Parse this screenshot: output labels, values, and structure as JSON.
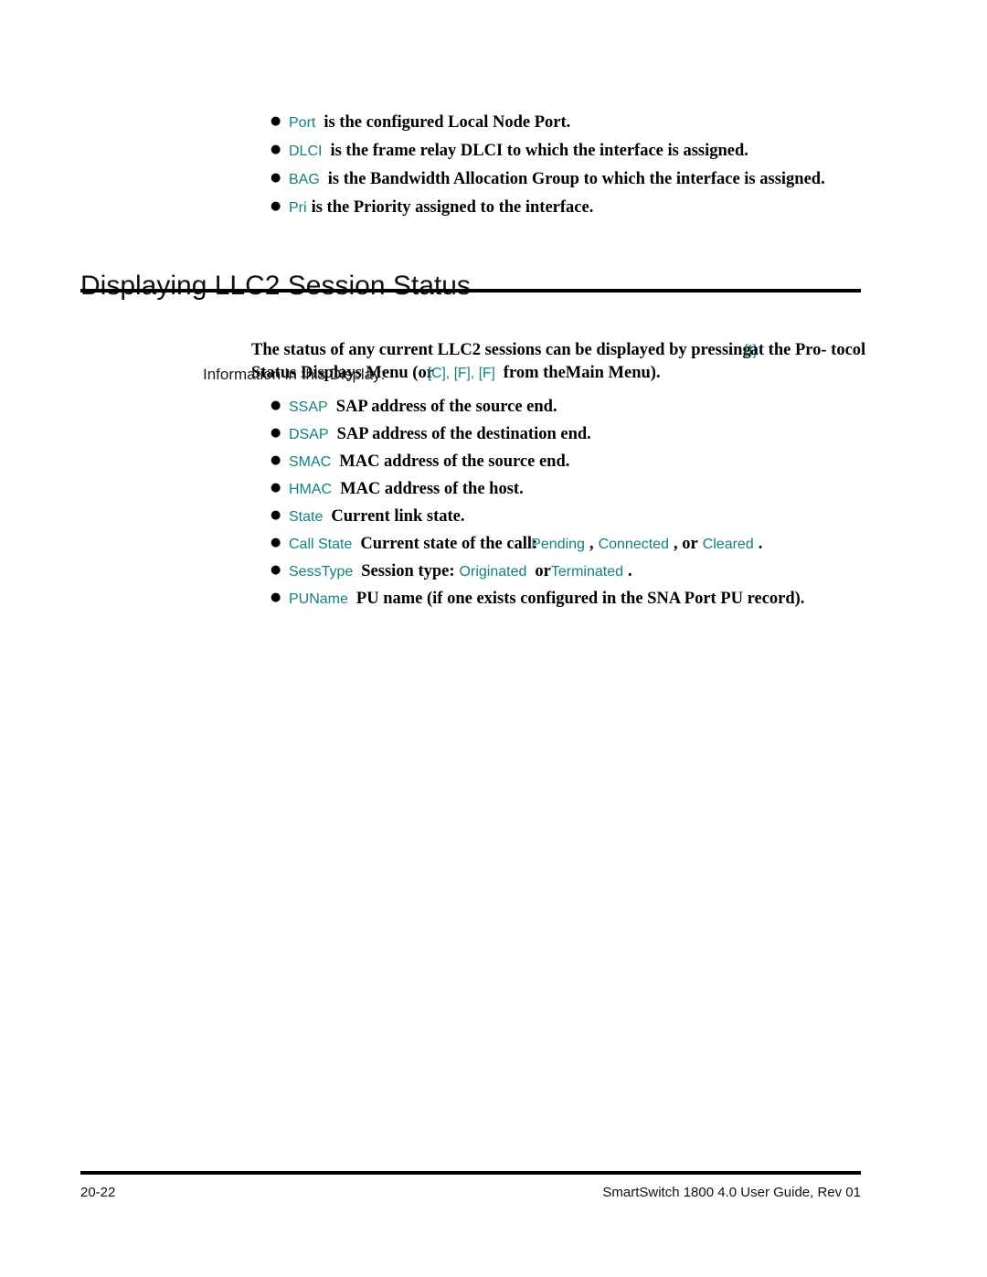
{
  "document": {
    "page_number": "20-22",
    "footer_title": "SmartSwitch 1800 4.0 User Guide, Rev 01",
    "accent_color": "#12807e"
  },
  "top_list": {
    "items": [
      {
        "term": "Port",
        "desc": "is the configured Local Node Port."
      },
      {
        "term": "DLCI",
        "desc": "is the frame relay DLCI to which the interface is assigned."
      },
      {
        "term": "BAG",
        "desc": "is the Bandwidth Allocation Group to which the interface is assigned."
      },
      {
        "term": "Pri",
        "desc": "is the Priority assigned to the interface."
      }
    ]
  },
  "section": {
    "heading": "Displaying LLC2 Session Status",
    "intro": {
      "part1": "The status of any current LLC2 sessions can be displayed by pressing",
      "key1": "[I]",
      "part2": "at the Pro-",
      "part3": "tocol Status Displays Menu (or",
      "key2": "[C],",
      "key3": "[F],",
      "key4": "[F]",
      "part4": "from the",
      "part5": "Main Menu)."
    },
    "info_label": "Information in this Display:"
  },
  "field_list": {
    "items": [
      {
        "term": "SSAP",
        "desc": "SAP address of the source end."
      },
      {
        "term": "DSAP",
        "desc": "SAP address of the destination end."
      },
      {
        "term": "SMAC",
        "desc": "MAC address of the source end."
      },
      {
        "term": "HMAC",
        "desc": "MAC address of the host."
      },
      {
        "term": "State",
        "desc": "Current link state."
      }
    ],
    "call_state": {
      "term": "Call State",
      "desc": "Current state of the call:",
      "value1": "Pending",
      "sep1": ",",
      "value2": "Connected",
      "sep2": ", or",
      "value3": "Cleared",
      "period": "."
    },
    "sess_type": {
      "term": "SessType",
      "desc": "Session type:",
      "value1": "Originated",
      "sep1": "or",
      "value2": "Terminated",
      "period": "."
    },
    "pu_name": {
      "term": "PUName",
      "desc": "PU name (if one exists configured in the SNA Port PU record)."
    }
  }
}
